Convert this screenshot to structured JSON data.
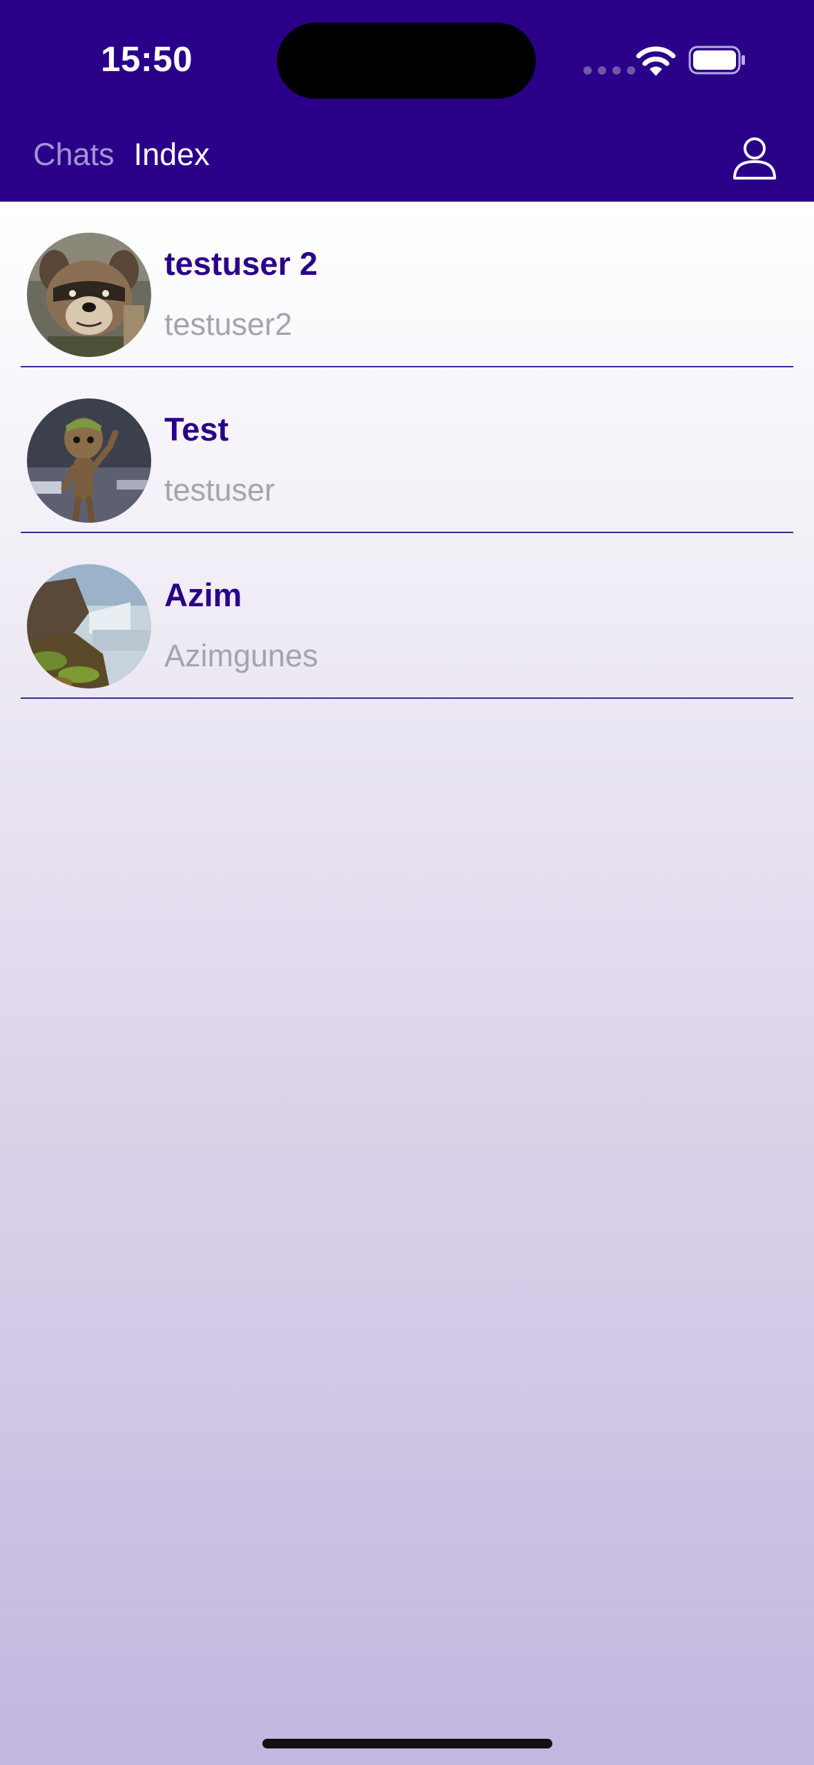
{
  "status_bar": {
    "time": "15:50"
  },
  "nav": {
    "tabs": [
      {
        "label": "Chats",
        "active": false
      },
      {
        "label": "Index",
        "active": true
      }
    ],
    "profile_icon": "person-icon"
  },
  "contacts": [
    {
      "name": "testuser 2",
      "username": "testuser2",
      "avatar": "raccoon-avatar"
    },
    {
      "name": "Test",
      "username": "testuser",
      "avatar": "tree-character-avatar"
    },
    {
      "name": "Azim",
      "username": "Azimgunes",
      "avatar": "waterfall-avatar"
    }
  ],
  "colors": {
    "header": "#2a0089",
    "name_text": "#2a0089",
    "username_text": "#a6a3ab",
    "divider": "#3a2791"
  }
}
